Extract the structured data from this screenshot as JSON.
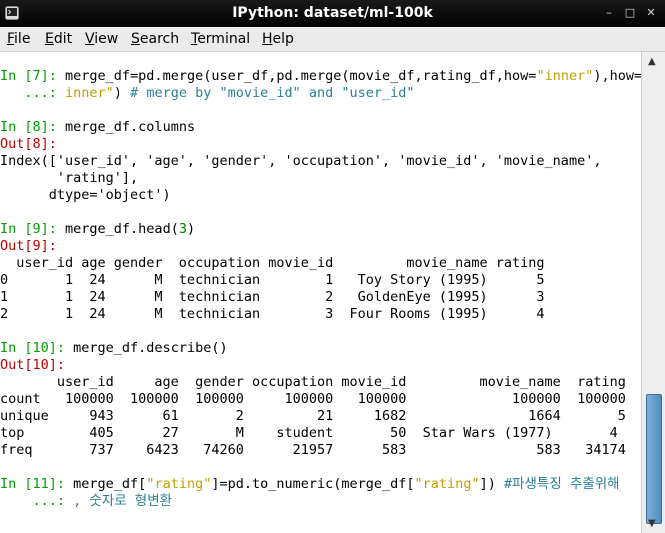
{
  "window": {
    "title": "IPython: dataset/ml-100k"
  },
  "menu": [
    {
      "key": "F",
      "rest": "ile"
    },
    {
      "key": "E",
      "rest": "dit"
    },
    {
      "key": "V",
      "rest": "iew"
    },
    {
      "key": "S",
      "rest": "earch"
    },
    {
      "key": "T",
      "rest": "erminal"
    },
    {
      "key": "H",
      "rest": "elp"
    }
  ],
  "console": {
    "in7_prompt": "In [7]: ",
    "in7_code_a": "merge_df=pd.merge(user_df,pd.merge(movie_df,rating_df,how=",
    "in7_str_a": "\"inner\"",
    "in7_code_b": "),how=",
    "in7_str_b": "\"",
    "cont_prompt": "   ...: ",
    "in7_str_c": "inner\"",
    "in7_code_c": ") ",
    "in7_comment": "# merge by \"movie_id\" and \"user_id\"",
    "in8_prompt": "In [8]: ",
    "in8_code": "merge_df.columns",
    "out8_prompt": "Out[8]:",
    "out8_lines": [
      "Index(['user_id', 'age', 'gender', 'occupation', 'movie_id', 'movie_name',",
      "       'rating'],",
      "      dtype='object')"
    ],
    "in9_prompt": "In [9]: ",
    "in9_code": "merge_df.head(",
    "in9_num": "3",
    "in9_close": ")",
    "out9_prompt": "Out[9]:",
    "head_header": "  user_id age gender  occupation movie_id         movie_name rating",
    "head_rows": [
      "0       1  24      M  technician        1   Toy Story (1995)      5",
      "1       1  24      M  technician        2   GoldenEye (1995)      3",
      "2       1  24      M  technician        3  Four Rooms (1995)      4"
    ],
    "in10_prompt": "In [10]: ",
    "in10_code": "merge_df.describe()",
    "out10_prompt": "Out[10]:",
    "desc_header": "       user_id     age  gender occupation movie_id         movie_name  rating",
    "desc_rows": [
      "count   100000  100000  100000     100000   100000             100000  100000",
      "unique     943      61       2         21     1682               1664       5",
      "top        405      27       M    student       50  Star Wars (1977)       4",
      "freq       737    6423   74260      21957      583                583   34174"
    ],
    "in11_prompt": "In [11]: ",
    "in11_code_a": "merge_df[",
    "in11_str_a": "\"rating\"",
    "in11_code_b": "]=pd.to_numeric(merge_df[",
    "in11_str_b": "\"rating\"",
    "in11_code_c": "]) ",
    "in11_comment": "#파생특징 추출위해",
    "cont_prompt2": "    ...: ",
    "in11_comment2": ", 숫자로 형변환"
  }
}
